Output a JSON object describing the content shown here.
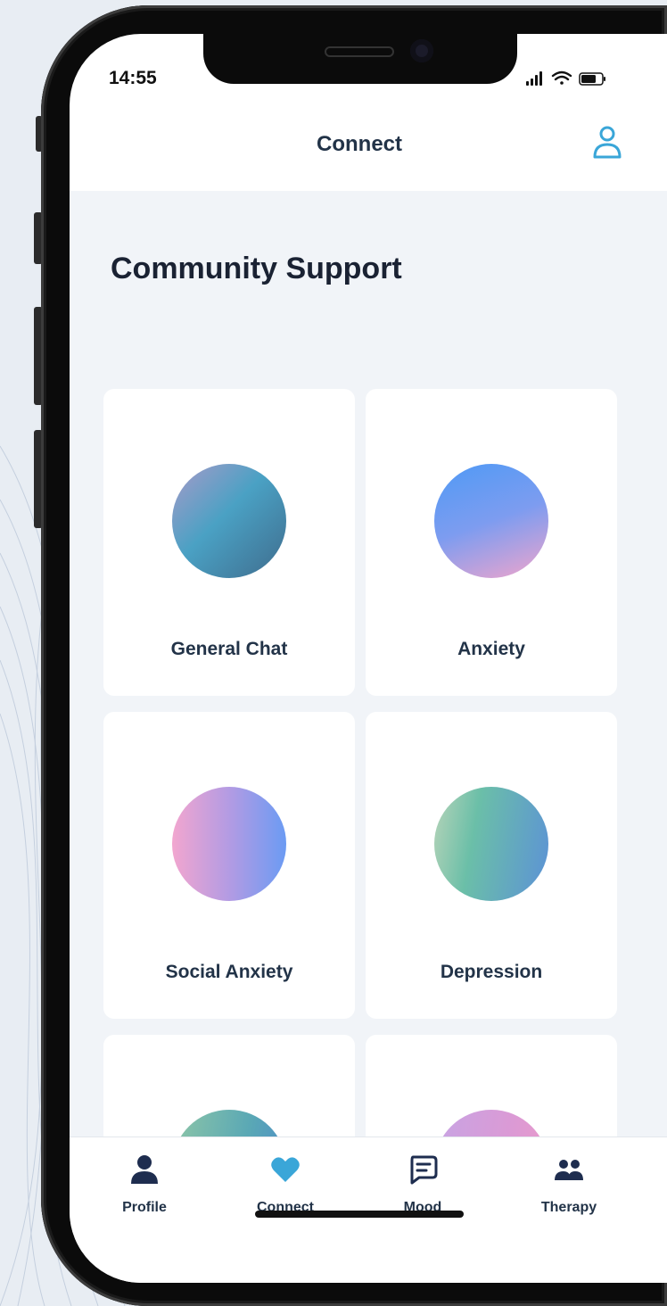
{
  "status_bar": {
    "time": "14:55"
  },
  "header": {
    "title": "Connect",
    "account_icon": "person-outline-icon"
  },
  "section": {
    "title": "Community Support"
  },
  "cards": [
    {
      "label": "General Chat",
      "orb_icon": "gradient-orb"
    },
    {
      "label": "Anxiety",
      "orb_icon": "gradient-orb"
    },
    {
      "label": "Social Anxiety",
      "orb_icon": "gradient-orb"
    },
    {
      "label": "Depression",
      "orb_icon": "gradient-orb"
    }
  ],
  "tabs": [
    {
      "label": "Profile",
      "icon": "person-icon"
    },
    {
      "label": "Connect",
      "icon": "heart-icon",
      "active": true
    },
    {
      "label": "Mood",
      "icon": "chat-bubble-icon"
    },
    {
      "label": "Therapy",
      "icon": "group-icon"
    }
  ],
  "colors": {
    "accent": "#3aa6d8",
    "text_dark": "#223348",
    "content_bg": "#f1f4f8"
  }
}
